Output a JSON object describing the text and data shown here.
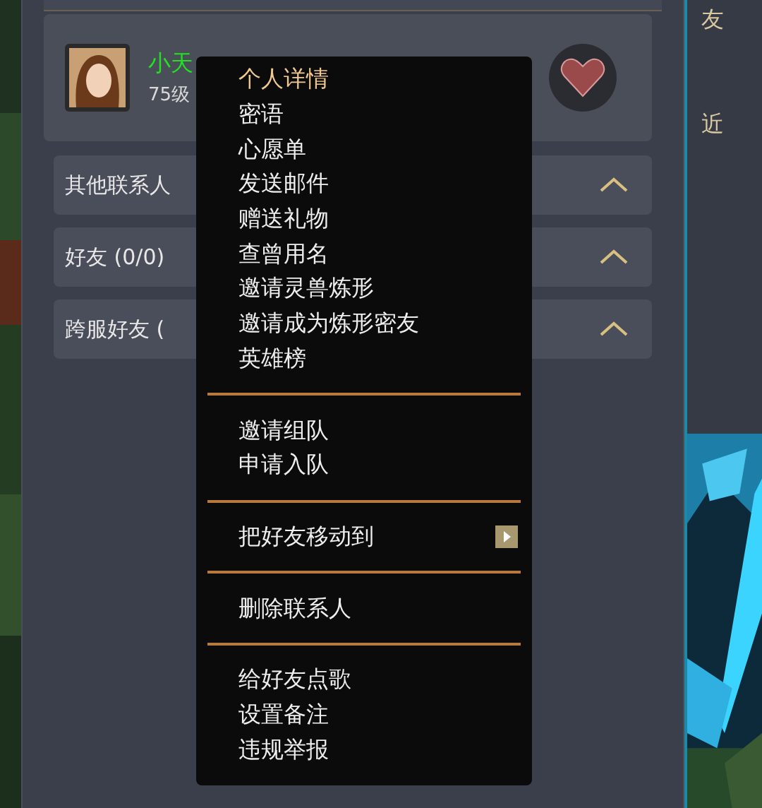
{
  "friend": {
    "name": "小天",
    "level": "75级"
  },
  "groups": [
    {
      "label": "其他联系人"
    },
    {
      "label": "好友 (0/0)"
    },
    {
      "label": "跨服好友 ("
    }
  ],
  "side_panel": {
    "labels": [
      "友",
      "近"
    ]
  },
  "context_menu": {
    "items": [
      {
        "kind": "item",
        "label": "个人详情",
        "selected": true
      },
      {
        "kind": "item",
        "label": "密语",
        "selected": false
      },
      {
        "kind": "item",
        "label": "心愿单",
        "selected": false
      },
      {
        "kind": "item",
        "label": "发送邮件",
        "selected": false
      },
      {
        "kind": "item",
        "label": "赠送礼物",
        "selected": false
      },
      {
        "kind": "item",
        "label": "查曾用名",
        "selected": false
      },
      {
        "kind": "item",
        "label": "邀请灵兽炼形",
        "selected": false
      },
      {
        "kind": "item",
        "label": "邀请成为炼形密友",
        "selected": false
      },
      {
        "kind": "item",
        "label": "英雄榜",
        "selected": false
      },
      {
        "kind": "separator"
      },
      {
        "kind": "item",
        "label": "邀请组队",
        "selected": false
      },
      {
        "kind": "item",
        "label": "申请入队",
        "selected": false
      },
      {
        "kind": "separator"
      },
      {
        "kind": "submenu",
        "label": "把好友移动到",
        "selected": false
      },
      {
        "kind": "separator"
      },
      {
        "kind": "item",
        "label": "删除联系人",
        "selected": false
      },
      {
        "kind": "separator"
      },
      {
        "kind": "item",
        "label": "给好友点歌",
        "selected": false
      },
      {
        "kind": "item",
        "label": "设置备注",
        "selected": false
      },
      {
        "kind": "item",
        "label": "违规举报",
        "selected": false
      }
    ]
  }
}
